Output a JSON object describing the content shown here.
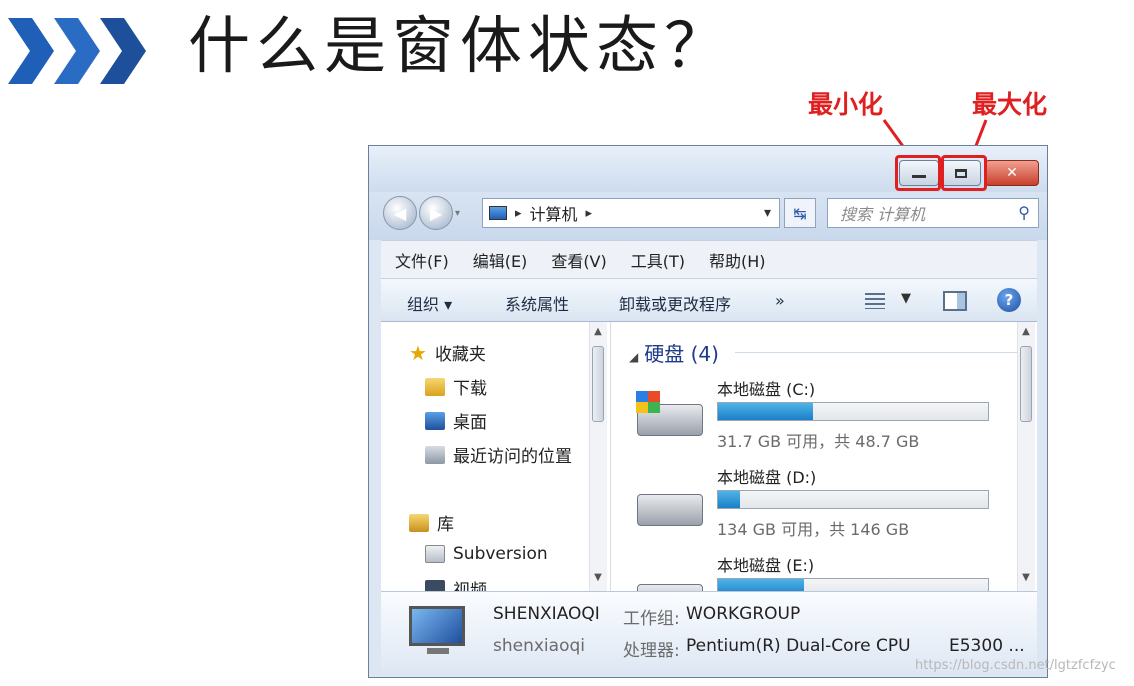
{
  "slide": {
    "title": "什么是窗体状态？",
    "annotation_minimize": "最小化",
    "annotation_maximize": "最大化",
    "accent_color": "#e02020",
    "watermark": "https://blog.csdn.net/lgtzfcfzyc"
  },
  "window": {
    "address": {
      "segment": "计算机",
      "separator": "▸",
      "dropdown": "▾"
    },
    "search": {
      "placeholder": "搜索 计算机"
    },
    "menu": [
      "文件(F)",
      "编辑(E)",
      "查看(V)",
      "工具(T)",
      "帮助(H)"
    ],
    "commands": {
      "organize": "组织 ▾",
      "system_properties": "系统属性",
      "uninstall": "卸载或更改程序",
      "more": "»"
    },
    "nav": {
      "favorites": "收藏夹",
      "downloads": "下载",
      "desktop": "桌面",
      "recent": "最近访问的位置",
      "libraries": "库",
      "subversion": "Subversion",
      "videos": "视频"
    },
    "content": {
      "group_title": "硬盘 (4)",
      "drives": [
        {
          "name": "本地磁盘 (C:)",
          "info": "31.7 GB 可用，共 48.7 GB",
          "used_fraction": 0.35
        },
        {
          "name": "本地磁盘 (D:)",
          "info": "134 GB 可用，共 146 GB",
          "used_fraction": 0.08
        },
        {
          "name": "本地磁盘 (E:)",
          "info": "",
          "used_fraction": 0.32
        }
      ]
    },
    "details": {
      "computer_name": "SHENXIAOQI",
      "workgroup_label": "工作组:",
      "workgroup": "WORKGROUP",
      "user": "shenxiaoqi",
      "processor_label": "处理器:",
      "processor": "Pentium(R) Dual-Core  CPU",
      "processor_model": "E5300 ..."
    }
  }
}
